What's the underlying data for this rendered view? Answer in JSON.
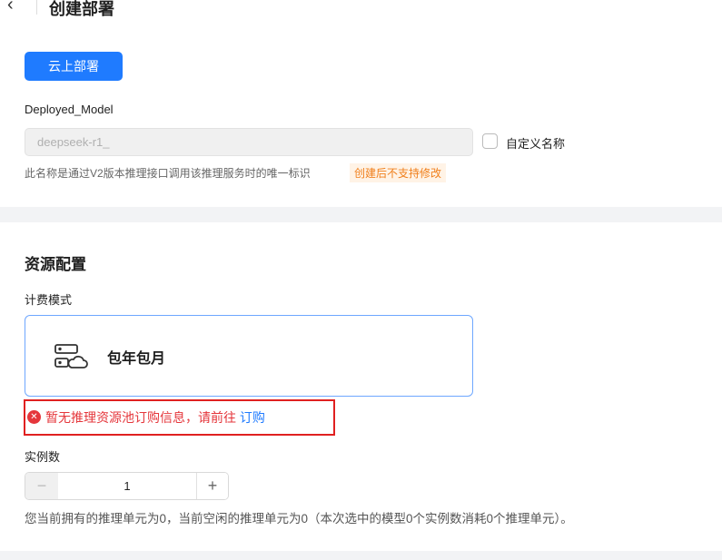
{
  "header": {
    "title": "创建部署"
  },
  "deploy": {
    "button": "云上部署",
    "model_label": "Deployed_Model",
    "model_value": "deepseek-r1_",
    "custom_name_label": "自定义名称",
    "hint": "此名称是通过V2版本推理接口调用该推理服务时的唯一标识",
    "tag": "创建后不支持修改"
  },
  "resource": {
    "title": "资源配置",
    "billing_label": "计费模式",
    "billing_option": "包年包月",
    "error_text": "暂无推理资源池订购信息，请前往",
    "error_link": "订购",
    "instances_label": "实例数",
    "instances_value": "1",
    "minus": "−",
    "plus": "+",
    "usage": "您当前拥有的推理单元为0，当前空闲的推理单元为0（本次选中的模型0个实例数消耗0个推理单元）。"
  }
}
